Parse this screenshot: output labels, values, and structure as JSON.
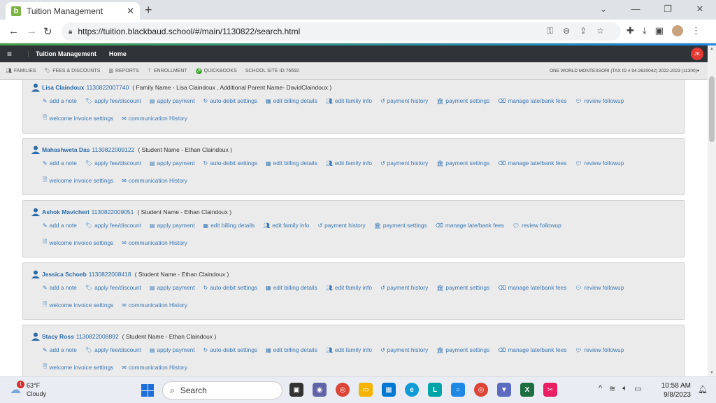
{
  "browser": {
    "tab_title": "Tuition Management",
    "favicon_letter": "b",
    "url": "https://tuition.blackbaud.school/#/main/1130822/search.html"
  },
  "app": {
    "name": "Tuition Management",
    "home": "Home",
    "user_initials": "JK"
  },
  "subnav": {
    "items": [
      "FAMILIES",
      "FEES & DISCOUNTS",
      "REPORTS",
      "ENROLLMENT",
      "QUICKBOOKS"
    ],
    "school_site": "SCHOOL SITE ID:76692",
    "school_info": "ONE WORLD MONTESSORI (TAX ID # 94-2630042) 2022-2023 (11300)"
  },
  "actions": {
    "add_note": "add a note",
    "apply_fee": "apply fee/discount",
    "apply_payment": "apply payment",
    "auto_debit": "auto-debit settings",
    "edit_billing": "edit billing details",
    "edit_family": "edit family info",
    "payment_history": "payment history",
    "payment_settings": "payment settings",
    "manage_late": "manage late/bank fees",
    "review_followup": "review followup",
    "welcome_invoice": "welcome invoice settings",
    "communication_history": "communication History"
  },
  "records": [
    {
      "name": "Lisa Claindoux",
      "id": "1130822007740",
      "relation": "( Family Name - Lisa Claindoux , Additional Parent Name- DavidClaindoux )"
    },
    {
      "name": "Mahashweta Das",
      "id": "1130822009122",
      "relation": "( Student Name - Ethan Claindoux )"
    },
    {
      "name": "Ashok Mavicheri",
      "id": "1130822009051",
      "relation": "( Student Name - Ethan Claindoux )"
    },
    {
      "name": "Jessica Schoeb",
      "id": "1130822008418",
      "relation": "( Student Name - Ethan Claindoux )"
    },
    {
      "name": "Stacy Ross",
      "id": "1130822008892",
      "relation": "( Student Name - Ethan Claindoux )"
    }
  ],
  "taskbar": {
    "weather_temp": "63°F",
    "weather_desc": "Cloudy",
    "weather_badge": "1",
    "search_label": "Search",
    "time": "10:58 AM",
    "date": "9/8/2023"
  },
  "colors": {
    "link": "#3b78b5",
    "app_header": "#2f3338",
    "card_bg": "#ebebeb"
  }
}
